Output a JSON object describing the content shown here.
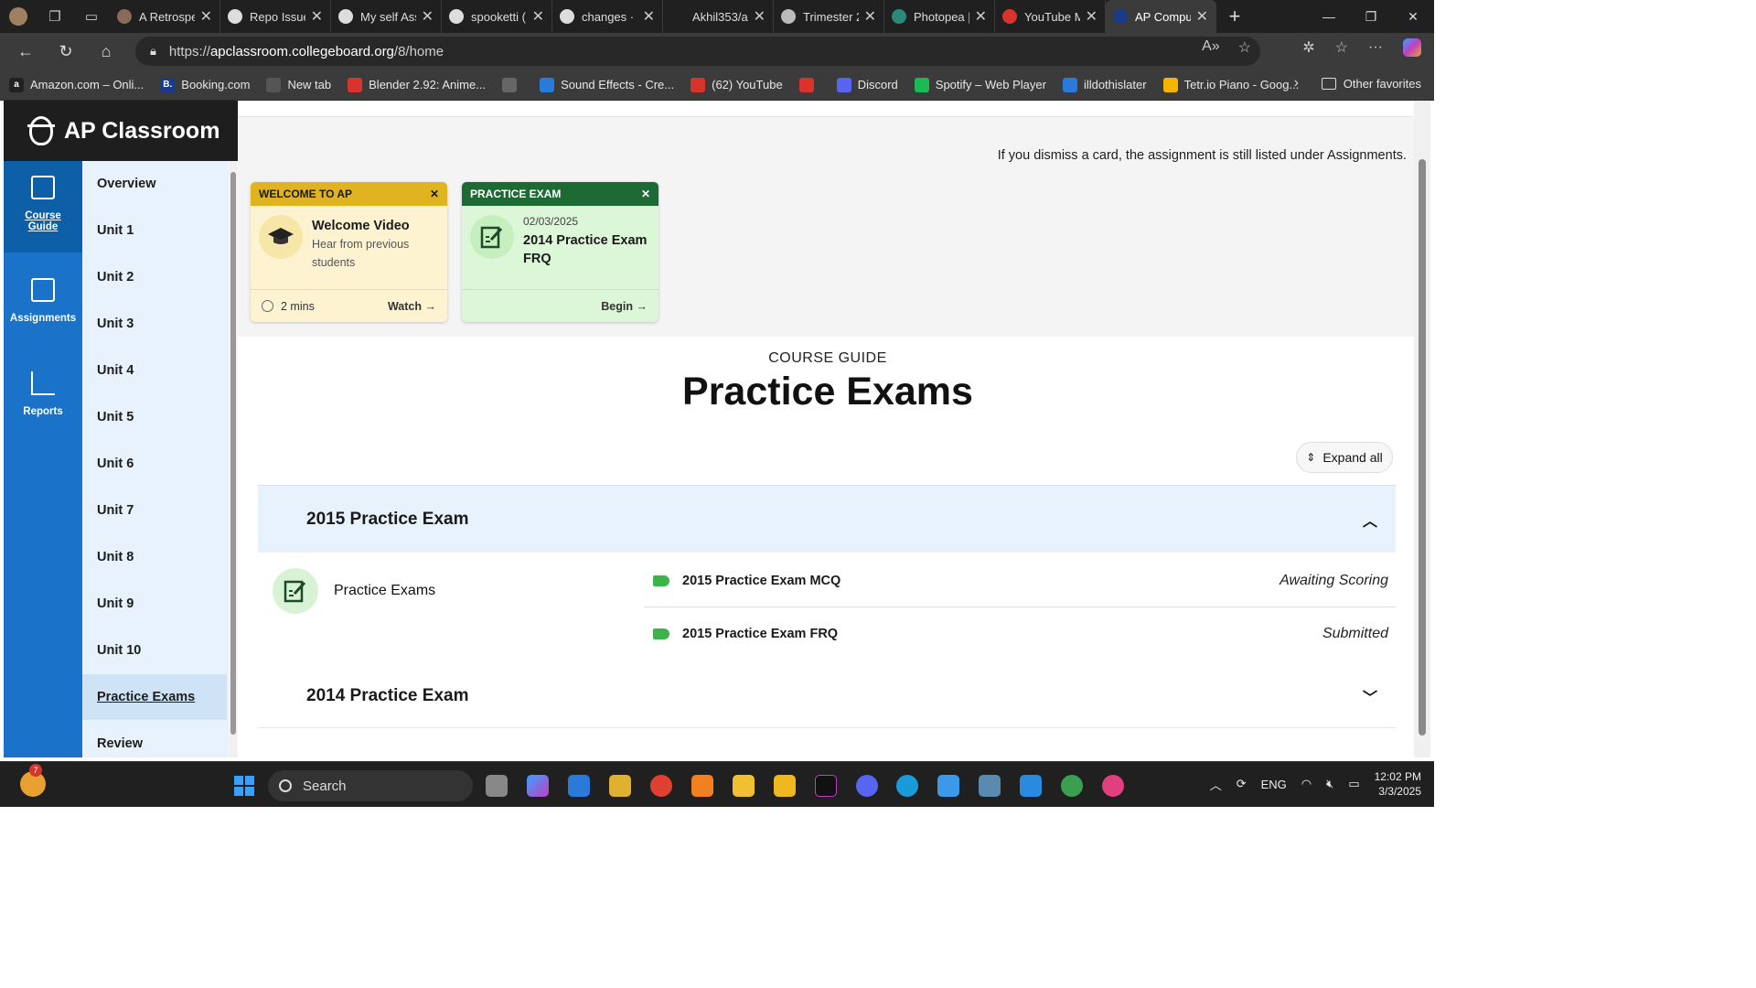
{
  "browser": {
    "tabs": [
      {
        "title": "A Retrospe",
        "color": "#8a6a5a"
      },
      {
        "title": "Repo Issue",
        "color": "#dddddd"
      },
      {
        "title": "My self Ass",
        "color": "#dddddd"
      },
      {
        "title": "spooketti (",
        "color": "#dddddd"
      },
      {
        "title": "changes · S",
        "color": "#dddddd"
      },
      {
        "title": "Akhil353/a",
        "color": "#202020"
      },
      {
        "title": "Trimester 2",
        "color": "#bbbbbb"
      },
      {
        "title": "Photopea |",
        "color": "#2a8a7a"
      },
      {
        "title": "YouTube M",
        "color": "#d9342b"
      },
      {
        "title": "AP Compu",
        "color": "#1a3a8a"
      }
    ],
    "url_scheme": "https://",
    "url_host": "apclassroom.collegeboard.org",
    "url_path": "/8/home",
    "favorites": [
      {
        "label": "Amazon.com – Onli...",
        "icon": "a",
        "color": "#222"
      },
      {
        "label": "Booking.com",
        "icon": "B.",
        "color": "#1a3a8a"
      },
      {
        "label": "New tab",
        "icon": "",
        "color": "#555"
      },
      {
        "label": "Blender 2.92: Anime...",
        "icon": "",
        "color": "#d9342b"
      },
      {
        "label": "",
        "icon": "",
        "color": "#666"
      },
      {
        "label": "Sound Effects - Cre...",
        "icon": "",
        "color": "#2a7ad9"
      },
      {
        "label": "(62) YouTube",
        "icon": "",
        "color": "#d9342b"
      },
      {
        "label": "",
        "icon": "",
        "color": "#d9342b"
      },
      {
        "label": "Discord",
        "icon": "",
        "color": "#5865f2"
      },
      {
        "label": "Spotify – Web Player",
        "icon": "",
        "color": "#1db954"
      },
      {
        "label": "illdothislater",
        "icon": "",
        "color": "#2a7ad9"
      },
      {
        "label": "Tetr.io Piano - Goog...",
        "icon": "",
        "color": "#f4b400"
      }
    ],
    "other_favorites": "Other favorites"
  },
  "app": {
    "logo": "AP Classroom",
    "rail": [
      {
        "label_1": "Course",
        "label_2": "Guide"
      },
      {
        "label_1": "Assignments",
        "label_2": ""
      },
      {
        "label_1": "Reports",
        "label_2": ""
      }
    ],
    "units": [
      "Overview",
      "Unit 1",
      "Unit 2",
      "Unit 3",
      "Unit 4",
      "Unit 5",
      "Unit 6",
      "Unit 7",
      "Unit 8",
      "Unit 9",
      "Unit 10",
      "Practice Exams",
      "Review"
    ]
  },
  "main": {
    "dismiss_note": "If you dismiss a card, the assignment is still listed under Assignments.",
    "cards": [
      {
        "header": "WELCOME TO AP",
        "header_color": "#e0b420",
        "body_color": "#fdf3d0",
        "date": "",
        "title": "Welcome Video",
        "subtitle": "Hear from previous students",
        "footer_left": "2 mins",
        "action": "Watch"
      },
      {
        "header": "PRACTICE EXAM",
        "header_color": "#1e6a34",
        "body_color": "#dcf6d8",
        "date": "02/03/2025",
        "title": "2014 Practice Exam FRQ",
        "subtitle": "",
        "footer_left": "",
        "action": "Begin"
      }
    ],
    "eyebrow": "COURSE GUIDE",
    "title": "Practice Exams",
    "expand_all": "Expand all",
    "sections": [
      {
        "title": "2015 Practice Exam",
        "expanded": true
      },
      {
        "title": "2014 Practice Exam",
        "expanded": false
      }
    ],
    "group_label": "Practice Exams",
    "rows": [
      {
        "name": "2015 Practice Exam MCQ",
        "status": "Awaiting Scoring"
      },
      {
        "name": "2015 Practice Exam FRQ",
        "status": "Submitted"
      }
    ]
  },
  "taskbar": {
    "weather_badge": "7",
    "search_placeholder": "Search",
    "language": "ENG",
    "time": "12:02 PM",
    "date": "3/3/2025"
  }
}
